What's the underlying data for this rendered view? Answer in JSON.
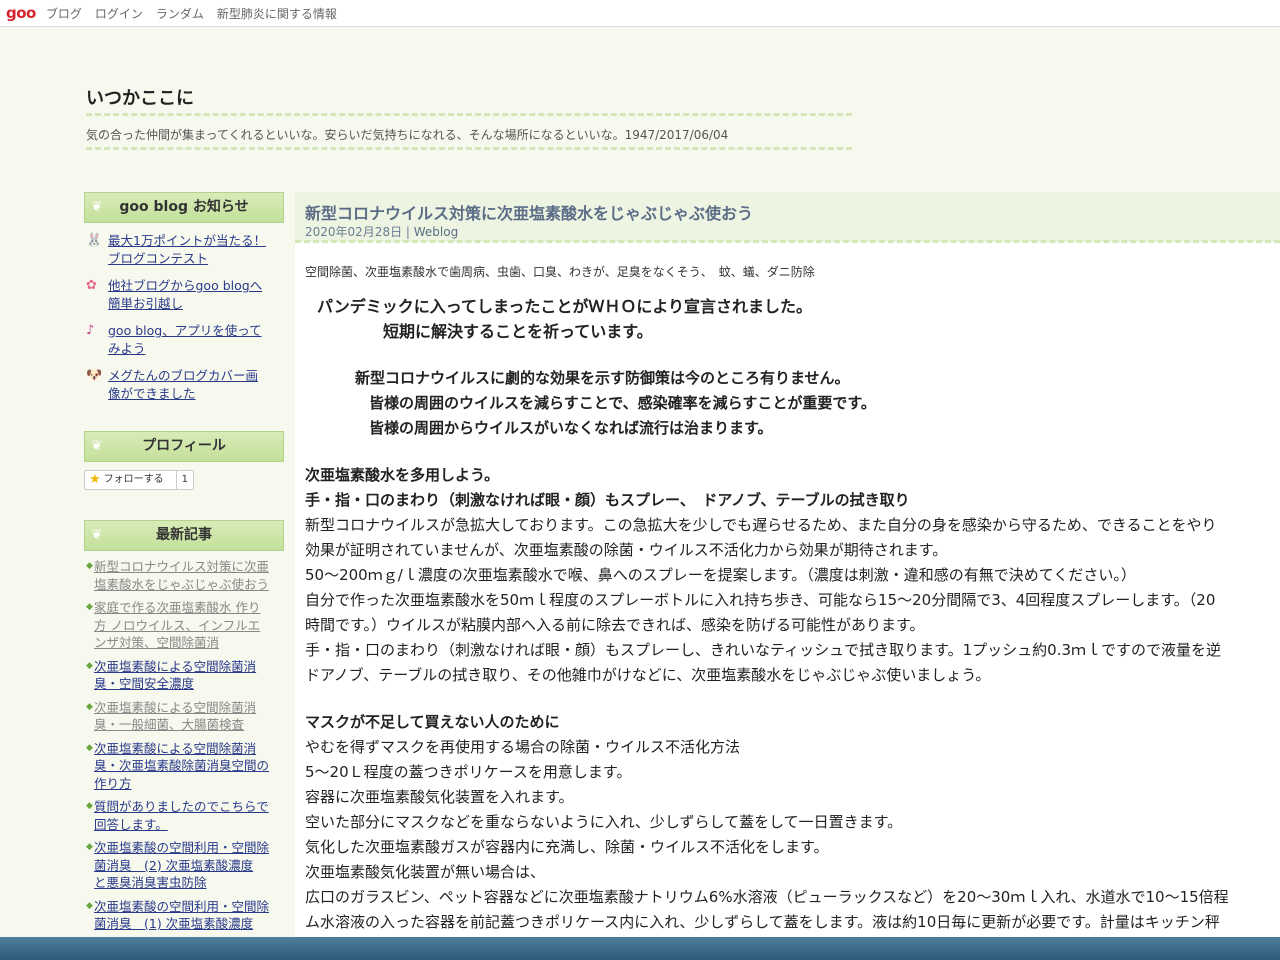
{
  "topbar": {
    "logo": "goo",
    "links": [
      "ブログ",
      "ログイン",
      "ランダム",
      "新型肺炎に関する情報"
    ]
  },
  "blog": {
    "title": "いつかここに",
    "description": "気の合った仲間が集まってくれるといいな。安らいだ気持ちになれる、そんな場所になるといいな。1947/2017/06/04"
  },
  "sidebar": {
    "notice_heading": "goo blog お知らせ",
    "notices": [
      {
        "icon": "🐰",
        "text_a": "最大1万ポイントが当たる！",
        "text_b": "ブログコンテスト"
      },
      {
        "icon": "✿",
        "text_a": "他社ブログからgoo blogへ",
        "text_b": "簡単お引越し"
      },
      {
        "icon": "♪",
        "text_a": "goo blog、アプリを使って",
        "text_b": "みよう"
      },
      {
        "icon": "🐶",
        "text_a": "メグたんのブログカバー画",
        "text_b": "像ができました"
      }
    ],
    "profile_heading": "プロフィール",
    "follow_label": "フォローする",
    "follow_count": "1",
    "recent_heading": "最新記事",
    "recent": [
      {
        "a": "新型コロナウイルス対策に次亜",
        "b": "塩素酸水をじゃぶじゃぶ使おう",
        "c": ""
      },
      {
        "a": "家庭で作る次亜塩素酸水 作り",
        "b": "方 ノロウイルス、インフルエ",
        "c": "ンザ対策、空間除菌消"
      },
      {
        "a": "次亜塩素酸による空間除菌消",
        "b": "臭・空間安全濃度",
        "c": ""
      },
      {
        "a": "次亜塩素酸による空間除菌消",
        "b": "臭・一般細菌、大腸菌検査",
        "c": ""
      },
      {
        "a": "次亜塩素酸による空間除菌消",
        "b": "臭・次亜塩素酸除菌消臭空間の",
        "c": "作り方"
      },
      {
        "a": "質問がありましたのでこちらで",
        "b": "回答します。",
        "c": ""
      },
      {
        "a": "次亜塩素酸の空間利用・空間除",
        "b": "菌消臭　(2) 次亜塩素酸濃度",
        "c": "と悪臭消臭害虫防除"
      },
      {
        "a": "次亜塩素酸の空間利用・空間除",
        "b": "菌消臭　(1) 次亜塩素酸濃度",
        "c": ""
      }
    ]
  },
  "article": {
    "title": "新型コロナウイルス対策に次亜塩素酸水をじゃぶじゃぶ使おう",
    "date": "2020年02月28日",
    "category": "Weblog",
    "tags": "空間除菌、次亜塩素酸水で歯周病、虫歯、口臭、わきが、足臭をなくそう、　蚊、蟻、ダニ防除",
    "lead1": "パンデミックに入ってしまったことがＷＨＯにより宣言されました。",
    "lead2": "短期に解決することを祈っています。",
    "lead3": "新型コロナウイルスに劇的な効果を示す防御策は今のところ有りません。",
    "lead4": "皆様の周囲のウイルスを減らすことで、感染確率を減らすことが重要です。",
    "lead5": "皆様の周囲からウイルスがいなくなれば流行は治まります。",
    "h1": "次亜塩素酸水を多用しよう。",
    "h2": "手・指・口のまわり（刺激なければ眼・顔）もスプレー、　ドアノブ、テーブルの拭き取り",
    "p1": "新型コロナウイルスが急拡大しております。この急拡大を少しでも遅らせるため、また自分の身を感染から守るため、できることをやり",
    "p2": "効果が証明されていませんが、次亜塩素酸の除菌・ウイルス不活化力から効果が期待されます。",
    "p3": "50〜200ｍｇ/ｌ濃度の次亜塩素酸水で喉、鼻へのスプレーを提案します。（濃度は刺激・違和感の有無で決めてください。）",
    "p4": "自分で作った次亜塩素酸水を50ｍｌ程度のスプレーボトルに入れ持ち歩き、可能なら15〜20分間隔で3、4回程度スプレーします。（20",
    "p5": "時間です。）ウイルスが粘膜内部へ入る前に除去できれば、感染を防げる可能性があります。",
    "p6": "手・指・口のまわり（刺激なければ眼・顔）もスプレーし、きれいなティッシュで拭き取ります。1プッシュ約0.3ｍｌですので液量を逆",
    "p7": "ドアノブ、テーブルの拭き取り、その他雑巾がけなどに、次亜塩素酸水をじゃぶじゃぶ使いましょう。",
    "h3": "マスクが不足して買えない人のために",
    "q1": "やむを得ずマスクを再使用する場合の除菌・ウイルス不活化方法",
    "q2": "5〜20Ｌ程度の蓋つきポリケースを用意します。",
    "q3": "容器に次亜塩素酸気化装置を入れます。",
    "q4": "空いた部分にマスクなどを重ならないように入れ、少しずらして蓋をして一日置きます。",
    "q5": "気化した次亜塩素酸ガスが容器内に充満し、除菌・ウイルス不活化をします。",
    "q6": "次亜塩素酸気化装置が無い場合は、",
    "q7": "広口のガラスビン、ペット容器などに次亜塩素酸ナトリウム6%水溶液（ピューラックスなど）を20〜30ｍｌ入れ、水道水で10〜15倍程",
    "q8": "ム水溶液の入った容器を前記蓋つきポリケース内に入れ、少しずらして蓋をします。液は約10日毎に更新が必要です。計量はキッチン秤"
  }
}
